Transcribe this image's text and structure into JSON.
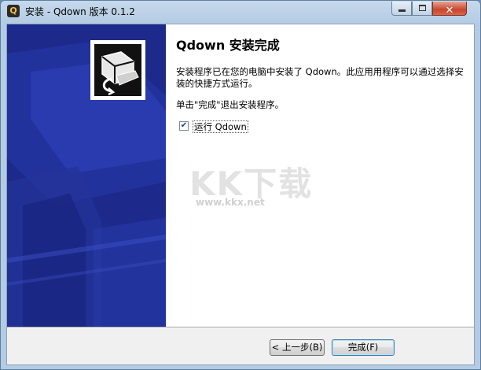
{
  "window": {
    "title": "安装 - Qdown 版本 0.1.2",
    "app_icon_glyph": "Q",
    "controls": {
      "minimize": "minimize",
      "maximize": "maximize",
      "close": "✕"
    }
  },
  "page": {
    "heading": "Qdown 安装完成",
    "body": "安装程序已在您的电脑中安装了 Qdown。此应用用程序可以通过选择安装的快捷方式运行。",
    "exit_hint": "单击\"完成\"退出安装程序。",
    "run_checkbox": {
      "label": "运行 Qdown",
      "checked": true,
      "check_glyph": "✔"
    }
  },
  "watermark": {
    "text": "KK下载",
    "url": "www.kkx.net"
  },
  "buttons": {
    "back": "< 上一步(B)",
    "finish": "完成(F)"
  },
  "colors": {
    "side_panel": "#1d2a8c",
    "titlebar": "#b3cbe3",
    "close_button": "#c9462c"
  },
  "icons": [
    "app-q-icon",
    "installer-box-icon",
    "minimize-icon",
    "maximize-icon",
    "close-icon",
    "checkbox-checked-icon"
  ]
}
